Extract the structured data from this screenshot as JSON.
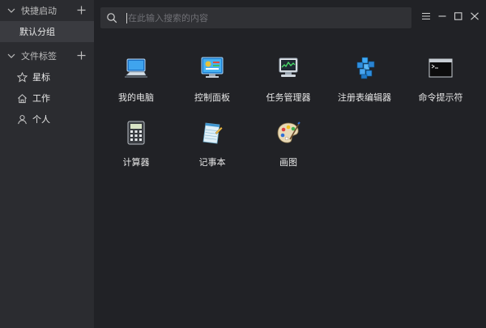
{
  "search": {
    "placeholder": "在此输入搜索的内容",
    "value": ""
  },
  "sidebar": {
    "quick_launch": {
      "title": "快捷启动",
      "groups": [
        {
          "label": "默认分组"
        }
      ]
    },
    "file_tags": {
      "title": "文件标签",
      "items": [
        {
          "label": "星标",
          "icon": "star-icon"
        },
        {
          "label": "工作",
          "icon": "home-icon"
        },
        {
          "label": "个人",
          "icon": "user-icon"
        }
      ]
    }
  },
  "apps": [
    {
      "label": "我的电脑",
      "icon": "computer-icon"
    },
    {
      "label": "控制面板",
      "icon": "control-panel-icon"
    },
    {
      "label": "任务管理器",
      "icon": "task-manager-icon"
    },
    {
      "label": "注册表编辑器",
      "icon": "registry-editor-icon"
    },
    {
      "label": "命令提示符",
      "icon": "command-prompt-icon"
    },
    {
      "label": "计算器",
      "icon": "calculator-icon"
    },
    {
      "label": "记事本",
      "icon": "notepad-icon"
    },
    {
      "label": "画图",
      "icon": "paint-icon"
    }
  ],
  "colors": {
    "background": "#212226",
    "sidebar": "#2b2c30",
    "active_item": "#3a3b40",
    "text": "#e6e6e6"
  }
}
